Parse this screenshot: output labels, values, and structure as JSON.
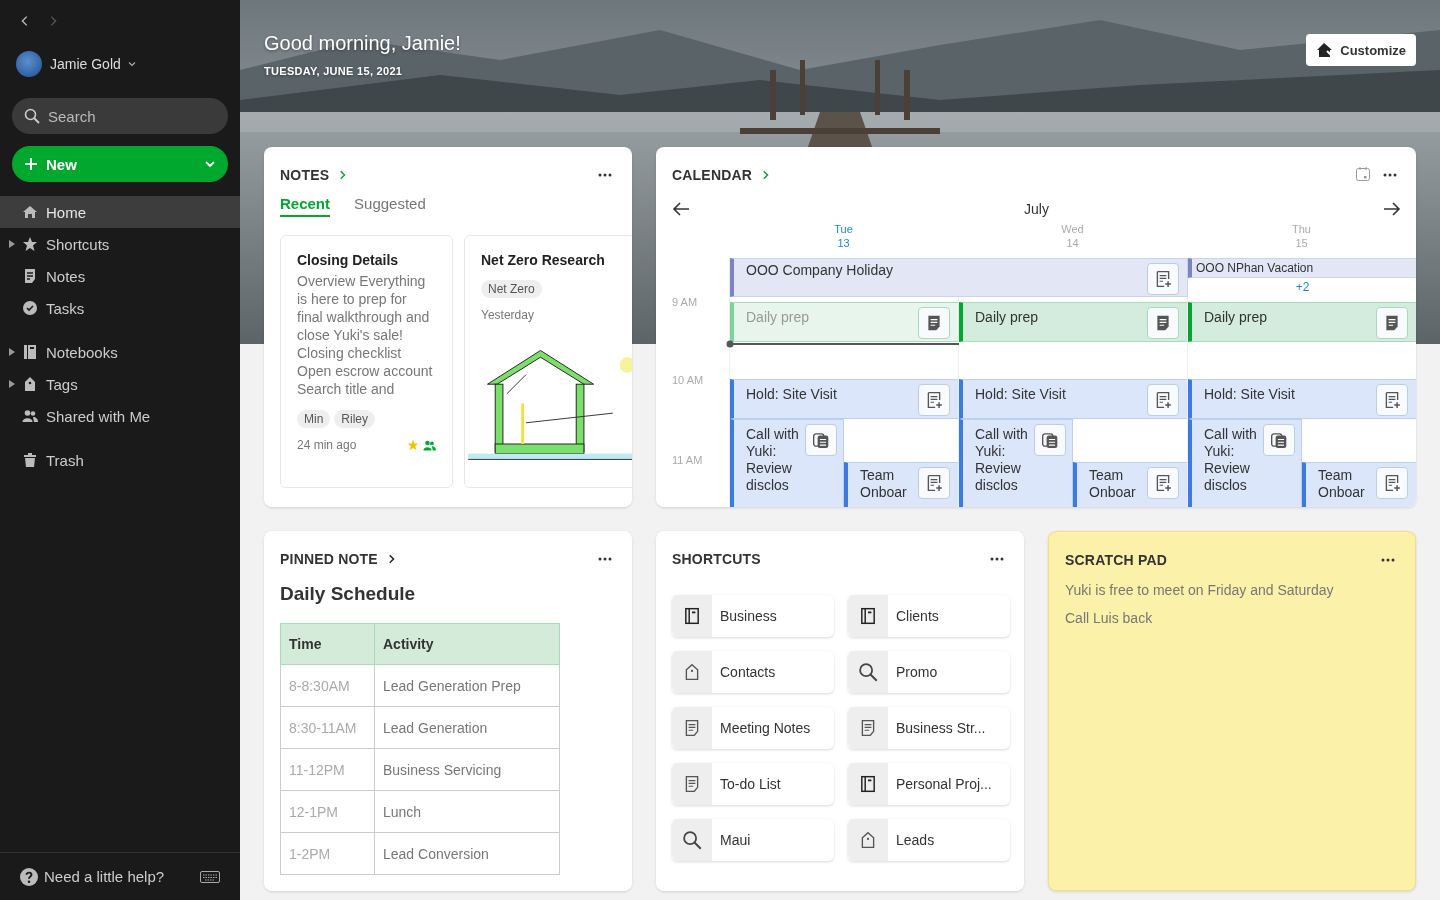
{
  "sidebar": {
    "user": "Jamie Gold",
    "search": {
      "placeholder": "Search"
    },
    "new_button": "New",
    "groups": [
      [
        {
          "label": "Home",
          "selected": true,
          "expandable": false
        },
        {
          "label": "Shortcuts",
          "selected": false,
          "expandable": true
        },
        {
          "label": "Notes",
          "selected": false,
          "expandable": false
        },
        {
          "label": "Tasks",
          "selected": false,
          "expandable": false
        }
      ],
      [
        {
          "label": "Notebooks",
          "selected": false,
          "expandable": true
        },
        {
          "label": "Tags",
          "selected": false,
          "expandable": true
        },
        {
          "label": "Shared with Me",
          "selected": false,
          "expandable": false
        }
      ],
      [
        {
          "label": "Trash",
          "selected": false,
          "expandable": false
        }
      ]
    ],
    "help": "Need a little help?"
  },
  "header": {
    "greeting": "Good morning, Jamie!",
    "date": "TUESDAY, JUNE 15, 2021",
    "customize": "Customize"
  },
  "notes": {
    "title": "NOTES",
    "tabs": [
      {
        "label": "Recent",
        "selected": true
      },
      {
        "label": "Suggested",
        "selected": false
      }
    ],
    "items": [
      {
        "title": "Closing Details",
        "snippet": "Overview Everything is here to prep for final walkthrough and close Yuki's sale! Closing checklist Open escrow account Search title and",
        "tags": [
          "Min",
          "Riley"
        ],
        "time": "24 min ago",
        "starred": true,
        "shared": true
      },
      {
        "title": "Net Zero Research",
        "tags": [
          "Net Zero"
        ],
        "time": "Yesterday",
        "starred": false,
        "shared": false,
        "kind": "picture"
      }
    ]
  },
  "calendar": {
    "title": "CALENDAR",
    "month": "July",
    "days": [
      {
        "weekday": "Tue",
        "date": "13",
        "selected": true
      },
      {
        "weekday": "Wed",
        "date": "14",
        "selected": false
      },
      {
        "weekday": "Thu",
        "date": "15",
        "selected": false
      }
    ],
    "times": [
      "9 AM",
      "10 AM",
      "11 AM"
    ],
    "all_day": [
      {
        "title": "OOO Company Holiday",
        "kind": "wide"
      },
      {
        "title": "OOO NPhan Vacation",
        "kind": "narrow",
        "more": "+2"
      }
    ],
    "columns": [
      {
        "events": [
          {
            "kind": "prep",
            "title": "Daily prep",
            "past": true
          },
          {
            "kind": "hold",
            "title": "Hold: Site Visit",
            "past": false
          },
          {
            "kind": "call",
            "title": "Call with Yuki: Review disclos",
            "past": false
          },
          {
            "kind": "team",
            "title": "Team Onboar",
            "past": false
          }
        ]
      },
      {
        "events": [
          {
            "kind": "prep",
            "title": "Daily prep",
            "past": false
          },
          {
            "kind": "hold",
            "title": "Hold: Site Visit",
            "past": false
          },
          {
            "kind": "call",
            "title": "Call with Yuki: Review disclos",
            "past": false
          },
          {
            "kind": "team",
            "title": "Team Onboar",
            "past": false
          }
        ]
      },
      {
        "events": [
          {
            "kind": "prep",
            "title": "Daily prep",
            "past": false
          },
          {
            "kind": "hold",
            "title": "Hold: Site Visit",
            "past": false
          },
          {
            "kind": "call",
            "title": "Call with Yuki: Review disclos",
            "past": false
          },
          {
            "kind": "team",
            "title": "Team Onboar",
            "past": false
          }
        ]
      }
    ]
  },
  "pinned_note": {
    "title": "PINNED NOTE",
    "note_title": "Daily Schedule",
    "table": {
      "columns": [
        "Time",
        "Activity"
      ],
      "rows": [
        [
          "8-8:30AM",
          "Lead Generation Prep"
        ],
        [
          "8:30-11AM",
          "Lead Generation"
        ],
        [
          "11-12PM",
          "Business Servicing"
        ],
        [
          "12-1PM",
          "Lunch"
        ],
        [
          "1-2PM",
          "Lead Conversion"
        ]
      ]
    }
  },
  "shortcuts": {
    "title": "SHORTCUTS",
    "items": [
      {
        "label": "Business",
        "kind": "notebook"
      },
      {
        "label": "Clients",
        "kind": "notebook"
      },
      {
        "label": "Contacts",
        "kind": "tag"
      },
      {
        "label": "Promo",
        "kind": "search"
      },
      {
        "label": "Meeting Notes",
        "kind": "note"
      },
      {
        "label": "Business Str...",
        "kind": "note"
      },
      {
        "label": "To-do List",
        "kind": "note"
      },
      {
        "label": "Personal Proj...",
        "kind": "notebook"
      },
      {
        "label": "Maui",
        "kind": "search"
      },
      {
        "label": "Leads",
        "kind": "tag"
      }
    ]
  },
  "scratch_pad": {
    "title": "SCRATCH PAD",
    "lines": [
      "Yuki is free to meet on Friday and Saturday",
      "Call Luis back"
    ]
  }
}
